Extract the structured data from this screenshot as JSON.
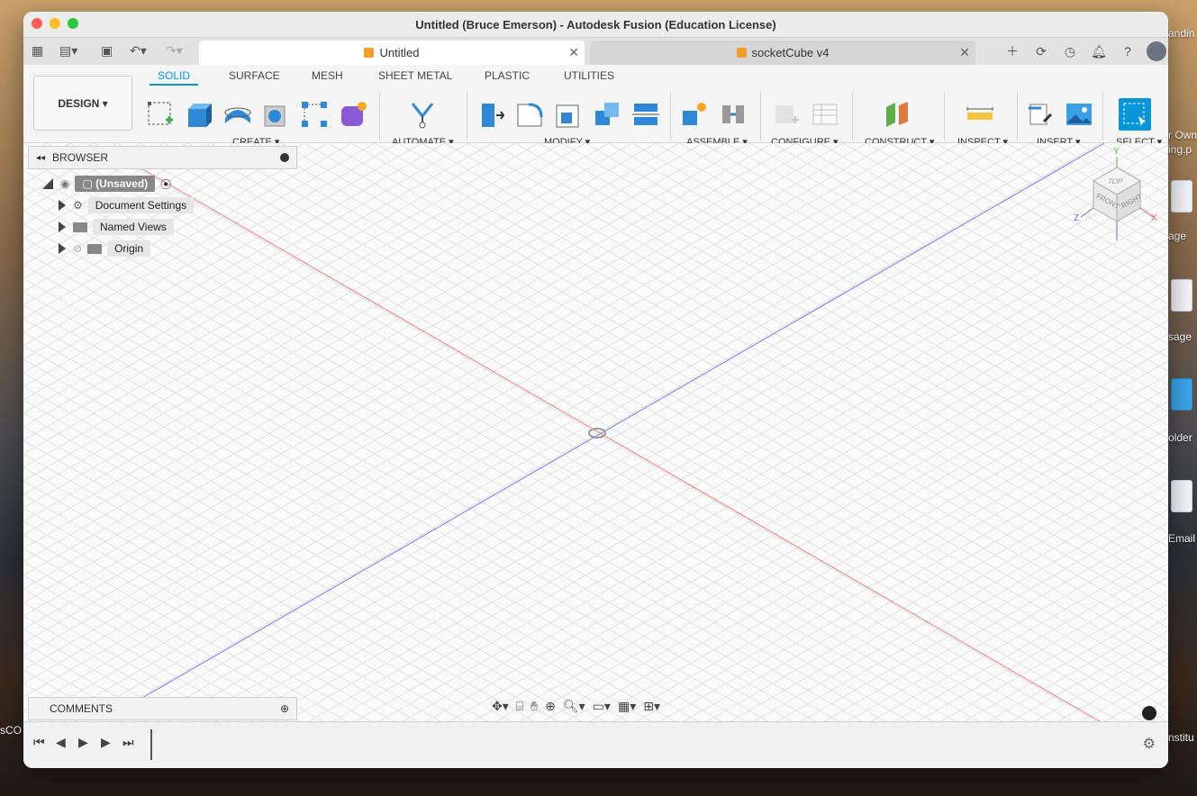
{
  "window": {
    "title": "Untitled (Bruce Emerson) - Autodesk Fusion (Education License)"
  },
  "tabs": [
    {
      "label": "Untitled",
      "active": true
    },
    {
      "label": "socketCube v4",
      "active": false
    }
  ],
  "workspace_tabs": [
    "SOLID",
    "SURFACE",
    "MESH",
    "SHEET METAL",
    "PLASTIC",
    "UTILITIES"
  ],
  "design_menu": {
    "label": "DESIGN"
  },
  "toolbar_groups": [
    {
      "label": "CREATE"
    },
    {
      "label": "AUTOMATE"
    },
    {
      "label": "MODIFY"
    },
    {
      "label": "ASSEMBLE"
    },
    {
      "label": "CONFIGURE"
    },
    {
      "label": "CONSTRUCT"
    },
    {
      "label": "INSPECT"
    },
    {
      "label": "INSERT"
    },
    {
      "label": "SELECT"
    }
  ],
  "browser": {
    "title": "BROWSER",
    "root": "(Unsaved)",
    "items": [
      "Document Settings",
      "Named Views",
      "Origin"
    ]
  },
  "comments": {
    "title": "COMMENTS"
  },
  "viewcube": {
    "top": "TOP",
    "front": "FRONT",
    "right": "RIGHT",
    "axes": {
      "x": "X",
      "y": "Y",
      "z": "Z"
    }
  },
  "desktop": {
    "fragments": [
      "andin",
      "r Own",
      "ing.p",
      "age",
      "sage",
      "older",
      "Email",
      "sCO",
      "nstitu"
    ]
  },
  "colors": {
    "accent": "#0696d7",
    "x_axis": "#e06060",
    "z_axis": "#6a6ae8"
  }
}
